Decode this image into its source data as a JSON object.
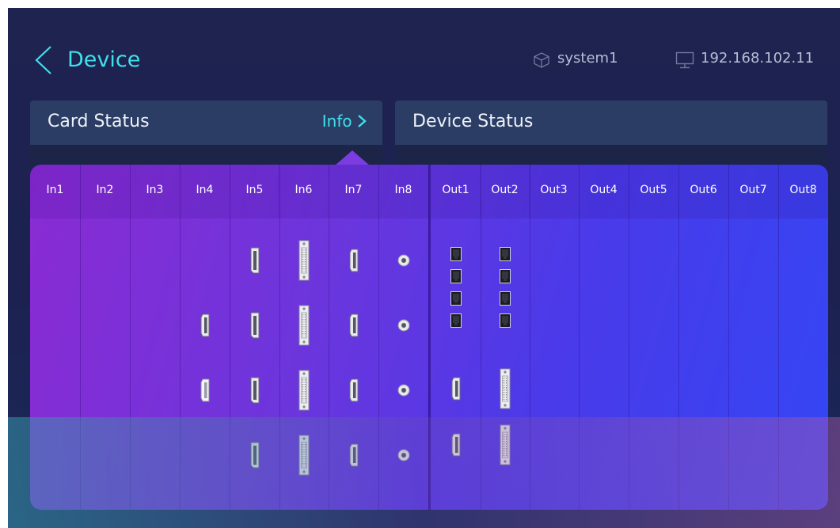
{
  "header": {
    "title": "Device",
    "system_name": "system1",
    "ip_address": "192.168.102.11"
  },
  "card_status": {
    "title": "Card Status",
    "info_label": "Info"
  },
  "device_status": {
    "title": "Device Status"
  },
  "inputs": [
    {
      "label": "In1",
      "ports": []
    },
    {
      "label": "In2",
      "ports": []
    },
    {
      "label": "In3",
      "ports": []
    },
    {
      "label": "In4",
      "ports": [
        "empty",
        "hdmi",
        "hdmi-light",
        "empty"
      ]
    },
    {
      "label": "In5",
      "ports": [
        "dp",
        "dp",
        "dp",
        "dp"
      ]
    },
    {
      "label": "In6",
      "ports": [
        "dvi",
        "dvi",
        "dvi",
        "dvi"
      ]
    },
    {
      "label": "In7",
      "ports": [
        "hdmi",
        "hdmi",
        "hdmi",
        "hdmi"
      ]
    },
    {
      "label": "In8",
      "ports": [
        "sdi",
        "sdi",
        "sdi",
        "sdi"
      ]
    }
  ],
  "outputs": [
    {
      "label": "Out1",
      "ports": [
        "rj45",
        "rj45",
        "rj45",
        "rj45",
        "hdmi",
        "hdmi"
      ]
    },
    {
      "label": "Out2",
      "ports": [
        "rj45",
        "rj45",
        "rj45",
        "rj45",
        "dvi",
        "dvi"
      ]
    },
    {
      "label": "Out3",
      "ports": []
    },
    {
      "label": "Out4",
      "ports": []
    },
    {
      "label": "Out5",
      "ports": []
    },
    {
      "label": "Out6",
      "ports": []
    },
    {
      "label": "Out7",
      "ports": []
    },
    {
      "label": "Out8",
      "ports": []
    }
  ],
  "colors": {
    "accent": "#3fe0ea",
    "background": "#1e2350",
    "header_panel": "#2b3d65",
    "popup_start": "#8a2bd3",
    "popup_end": "#3446f4"
  },
  "icons": {
    "back": "chevron-left-icon",
    "system": "cube-icon",
    "ip": "monitor-icon",
    "info": "chevron-right-icon"
  }
}
